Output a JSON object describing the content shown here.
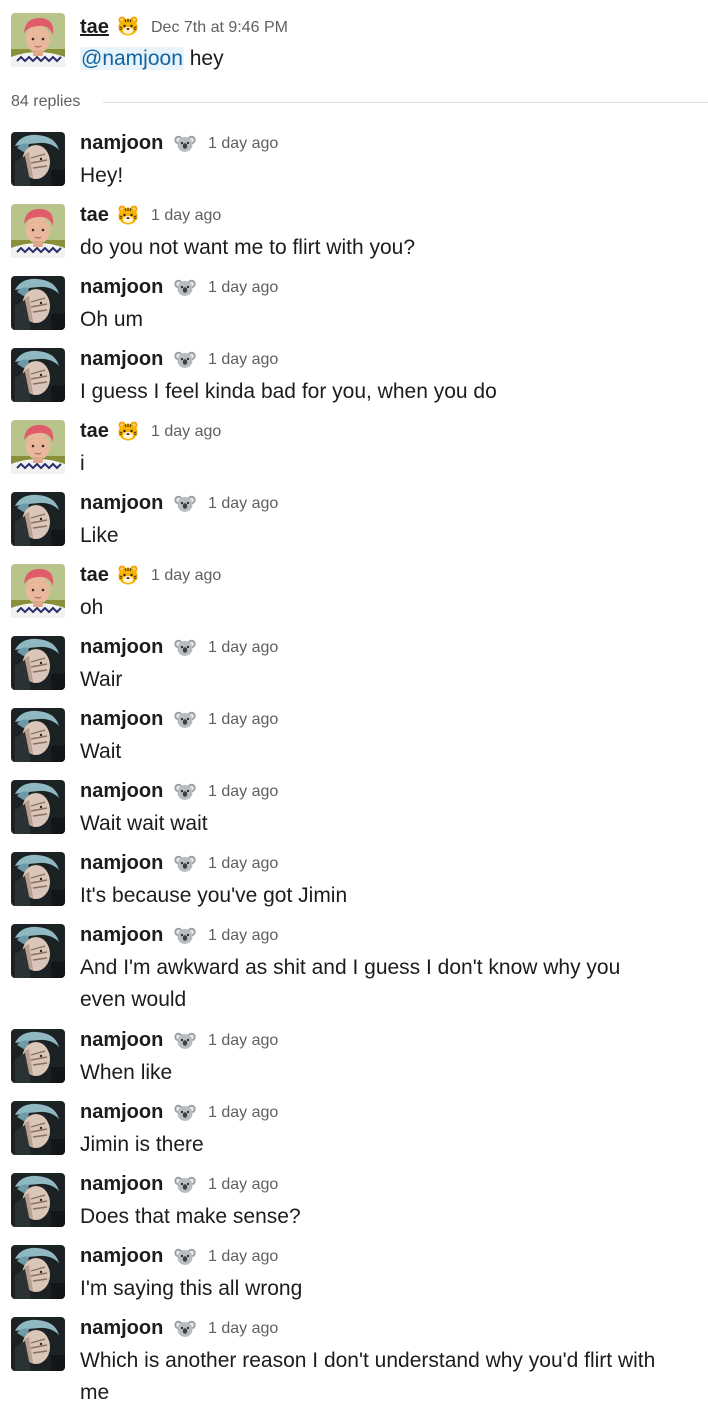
{
  "parent": {
    "author": "tae",
    "author_icon": "tiger-face-icon",
    "timestamp": "Dec 7th at 9:46 PM",
    "mention": "@namjoon",
    "text": "hey"
  },
  "thread": {
    "replies_label": "84 replies"
  },
  "messages": [
    {
      "author": "namjoon",
      "icon": "koala-icon",
      "time": "1 day ago",
      "text": "Hey!"
    },
    {
      "author": "tae",
      "icon": "tiger-face-icon",
      "time": "1 day ago",
      "text": "do you not want me to flirt with you?"
    },
    {
      "author": "namjoon",
      "icon": "koala-icon",
      "time": "1 day ago",
      "text": "Oh um"
    },
    {
      "author": "namjoon",
      "icon": "koala-icon",
      "time": "1 day ago",
      "text": "I guess I feel kinda bad for you, when you do"
    },
    {
      "author": "tae",
      "icon": "tiger-face-icon",
      "time": "1 day ago",
      "text": "i"
    },
    {
      "author": "namjoon",
      "icon": "koala-icon",
      "time": "1 day ago",
      "text": "Like"
    },
    {
      "author": "tae",
      "icon": "tiger-face-icon",
      "time": "1 day ago",
      "text": "oh"
    },
    {
      "author": "namjoon",
      "icon": "koala-icon",
      "time": "1 day ago",
      "text": "Wair"
    },
    {
      "author": "namjoon",
      "icon": "koala-icon",
      "time": "1 day ago",
      "text": "Wait"
    },
    {
      "author": "namjoon",
      "icon": "koala-icon",
      "time": "1 day ago",
      "text": "Wait wait wait"
    },
    {
      "author": "namjoon",
      "icon": "koala-icon",
      "time": "1 day ago",
      "text": "It's because you've got Jimin"
    },
    {
      "author": "namjoon",
      "icon": "koala-icon",
      "time": "1 day ago",
      "text": "And I'm awkward as shit and I guess I don't know why you even would"
    },
    {
      "author": "namjoon",
      "icon": "koala-icon",
      "time": "1 day ago",
      "text": "When like"
    },
    {
      "author": "namjoon",
      "icon": "koala-icon",
      "time": "1 day ago",
      "text": "Jimin is there"
    },
    {
      "author": "namjoon",
      "icon": "koala-icon",
      "time": "1 day ago",
      "text": "Does that make sense?"
    },
    {
      "author": "namjoon",
      "icon": "koala-icon",
      "time": "1 day ago",
      "text": "I'm saying this all wrong"
    },
    {
      "author": "namjoon",
      "icon": "koala-icon",
      "time": "1 day ago",
      "text": "Which is another reason I don't understand why you'd flirt with me"
    }
  ],
  "colors": {
    "link": "#1264a3",
    "mention_bg": "#e8f3fa",
    "muted": "#616061",
    "text": "#1d1c1d"
  }
}
